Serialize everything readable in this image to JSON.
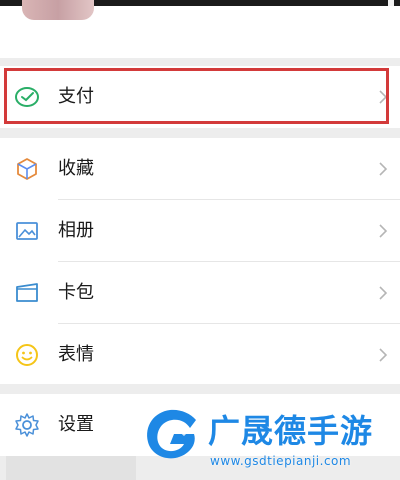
{
  "menu": {
    "payment_label": "支付",
    "favorites_label": "收藏",
    "album_label": "相册",
    "cards_label": "卡包",
    "stickers_label": "表情",
    "settings_label": "设置"
  },
  "watermark": {
    "title": "广晟德手游",
    "url": "www.gsdtiepianji.com"
  },
  "icons": {
    "payment": "wechat-pay-icon",
    "favorites": "cube-icon",
    "album": "picture-icon",
    "cards": "card-wallet-icon",
    "stickers": "smiley-icon",
    "settings": "gear-icon",
    "chevron": "chevron-right-icon"
  },
  "colors": {
    "highlight": "#d33a3a",
    "pay_icon": "#2aae67",
    "sticker_icon": "#f5c518",
    "watermark_blue": "#1e88e5"
  }
}
